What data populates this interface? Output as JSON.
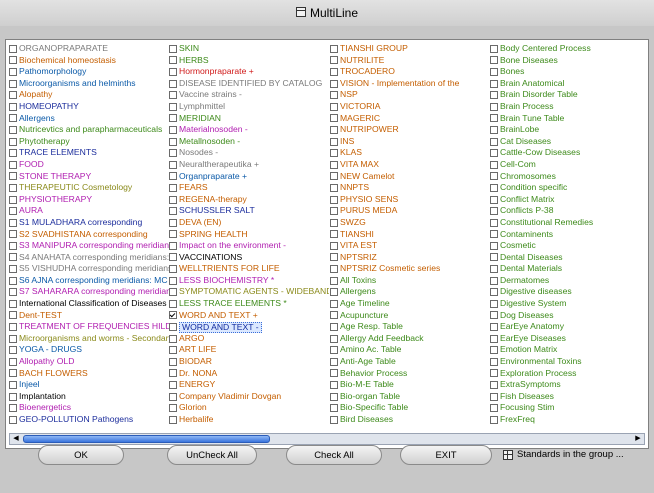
{
  "window": {
    "title": "MultiLine"
  },
  "columns": [
    [
      {
        "label": "ORGANOPRAPARATE",
        "color": "#7a7a7a"
      },
      {
        "label": "Biochemical homeostasis",
        "color": "#c45e00"
      },
      {
        "label": "Pathomorphology",
        "color": "#0b5aa8"
      },
      {
        "label": "Microorganisms and helminths",
        "color": "#0b5aa8"
      },
      {
        "label": "Alopathy",
        "color": "#c45e00"
      },
      {
        "label": "HOMEOPATHY",
        "color": "#1c2d9c"
      },
      {
        "label": "Allergens",
        "color": "#0b5aa8"
      },
      {
        "label": "Nutricevtics and parapharmaceuticals",
        "color": "#3d8a1a"
      },
      {
        "label": "Phytotherapy",
        "color": "#3d8a1a"
      },
      {
        "label": "TRACE ELEMENTS",
        "color": "#1c2d9c"
      },
      {
        "label": "FOOD",
        "color": "#b01eb0"
      },
      {
        "label": "STONE THERAPY",
        "color": "#b01eb0"
      },
      {
        "label": "THERAPEUTIC Cosmetology",
        "color": "#8a8a1a"
      },
      {
        "label": "PHYSIOTHERAPY",
        "color": "#b01eb0"
      },
      {
        "label": "AURA",
        "color": "#b01eb0"
      },
      {
        "label": "S1 MULADHARA corresponding",
        "color": "#1c2d9c"
      },
      {
        "label": "S2 SVADHISTANA corresponding",
        "color": "#c45e00"
      },
      {
        "label": "S3 MANIPURA corresponding meridians:",
        "color": "#b01eb0"
      },
      {
        "label": "S4 ANAHATA corresponding meridians:",
        "color": "#7a7a7a"
      },
      {
        "label": "S5 VISHUDHA corresponding meridians:",
        "color": "#7a7a7a"
      },
      {
        "label": "S6 AJNA corresponding meridians: MC",
        "color": "#0b5aa8"
      },
      {
        "label": "S7 SAHARARA corresponding meridians:",
        "color": "#b01eb0"
      },
      {
        "label": "International Classification of Diseases",
        "color": "#000000"
      },
      {
        "label": "Dent-TEST",
        "color": "#c45e00"
      },
      {
        "label": "TREATMENT OF FREQUENCIES HILDA",
        "color": "#b01eb0"
      },
      {
        "label": "Microorganisms and worms - Secondary",
        "color": "#8a8a1a"
      },
      {
        "label": "YOGA - DRUGS",
        "color": "#0b5aa8"
      },
      {
        "label": "Allopathy OLD",
        "color": "#b01eb0"
      },
      {
        "label": "BACH FLOWERS",
        "color": "#c45e00"
      },
      {
        "label": "Injeel",
        "color": "#0b5aa8"
      },
      {
        "label": "Implantation",
        "color": "#000000"
      },
      {
        "label": "Bioenergetics",
        "color": "#b01eb0"
      },
      {
        "label": "GEO-POLLUTION Pathogens",
        "color": "#1c2d9c"
      }
    ],
    [
      {
        "label": "SKIN",
        "color": "#3d8a1a"
      },
      {
        "label": "HERBS",
        "color": "#3d8a1a"
      },
      {
        "label": "Hormonpraparate +",
        "color": "#d01a1a"
      },
      {
        "label": "DISEASE IDENTIFIED BY CATALOG",
        "color": "#7a7a7a"
      },
      {
        "label": "Vaccine strains -",
        "color": "#7a7a7a"
      },
      {
        "label": "Lymphmittel",
        "color": "#7a7a7a"
      },
      {
        "label": "MERIDIAN",
        "color": "#3d8a1a"
      },
      {
        "label": "Materialnosoden -",
        "color": "#b01eb0"
      },
      {
        "label": "Metallnosoden -",
        "color": "#3d8a1a"
      },
      {
        "label": "Nosodes -",
        "color": "#7a7a7a"
      },
      {
        "label": "Neuraltherapeutika +",
        "color": "#7a7a7a"
      },
      {
        "label": "Organpraparate +",
        "color": "#0b5aa8"
      },
      {
        "label": "FEARS",
        "color": "#c45e00"
      },
      {
        "label": "REGENA-therapy",
        "color": "#c45e00"
      },
      {
        "label": "SCHUSSLER SALT",
        "color": "#1c2d9c"
      },
      {
        "label": "DEVA (EN)",
        "color": "#c45e00"
      },
      {
        "label": "SPRING HEALTH",
        "color": "#c45e00"
      },
      {
        "label": "Impact on the environment -",
        "color": "#b01eb0"
      },
      {
        "label": "VACCINATIONS",
        "color": "#000000"
      },
      {
        "label": "WELLTRIENTS FOR LIFE",
        "color": "#c45e00"
      },
      {
        "label": "LESS BIOCHEMISTRY *",
        "color": "#b01eb0"
      },
      {
        "label": "SYMPTOMATIC AGENTS - WIDEBAND",
        "color": "#8a8a1a"
      },
      {
        "label": "LESS TRACE ELEMENTS *",
        "color": "#3d8a1a"
      },
      {
        "label": "WORD AND TEXT +",
        "color": "#c45e00",
        "checked": true
      },
      {
        "label": "WORD AND TEXT -",
        "color": "#102a9e",
        "selected": true
      },
      {
        "label": "ARGO",
        "color": "#c45e00"
      },
      {
        "label": "ART LIFE",
        "color": "#c45e00"
      },
      {
        "label": "BIODAR",
        "color": "#c45e00"
      },
      {
        "label": "Dr. NONA",
        "color": "#c45e00"
      },
      {
        "label": "ENERGY",
        "color": "#c45e00"
      },
      {
        "label": "Company Vladimir Dovgan",
        "color": "#c45e00"
      },
      {
        "label": "Glorion",
        "color": "#c45e00"
      },
      {
        "label": "Herbalife",
        "color": "#c45e00"
      }
    ],
    [
      {
        "label": "TIANSHI GROUP",
        "color": "#c45e00"
      },
      {
        "label": "NUTRILITE",
        "color": "#c45e00"
      },
      {
        "label": "TROCADERO",
        "color": "#c45e00"
      },
      {
        "label": "VISION - Implementation of the",
        "color": "#c45e00"
      },
      {
        "label": "NSP",
        "color": "#c45e00"
      },
      {
        "label": "VICTORIA",
        "color": "#c45e00"
      },
      {
        "label": "MAGERIC",
        "color": "#c45e00"
      },
      {
        "label": "NUTRIPOWER",
        "color": "#c45e00"
      },
      {
        "label": "INS",
        "color": "#c45e00"
      },
      {
        "label": "KLAS",
        "color": "#c45e00"
      },
      {
        "label": "VITA MAX",
        "color": "#c45e00"
      },
      {
        "label": "NEW Camelot",
        "color": "#c45e00"
      },
      {
        "label": "NNPTS",
        "color": "#c45e00"
      },
      {
        "label": "PHYSIO SENS",
        "color": "#c45e00"
      },
      {
        "label": "PURUS MEDA",
        "color": "#c45e00"
      },
      {
        "label": "SWZG",
        "color": "#c45e00"
      },
      {
        "label": "TIANSHI",
        "color": "#c45e00"
      },
      {
        "label": "VITA EST",
        "color": "#c45e00"
      },
      {
        "label": "NPTSRIZ",
        "color": "#c45e00"
      },
      {
        "label": "NPTSRIZ Cosmetic series",
        "color": "#c45e00"
      },
      {
        "label": "All Toxins",
        "color": "#3d8a1a"
      },
      {
        "label": "Allergens",
        "color": "#3d8a1a"
      },
      {
        "label": "Age Timeline",
        "color": "#3d8a1a"
      },
      {
        "label": "Acupuncture",
        "color": "#3d8a1a"
      },
      {
        "label": "Age Resp. Table",
        "color": "#3d8a1a"
      },
      {
        "label": "Allergy Add Feedback",
        "color": "#3d8a1a"
      },
      {
        "label": "Amino Ac. Table",
        "color": "#3d8a1a"
      },
      {
        "label": "Anti-Age Table",
        "color": "#3d8a1a"
      },
      {
        "label": "Behavior Process",
        "color": "#3d8a1a"
      },
      {
        "label": "Bio-M-E Table",
        "color": "#3d8a1a"
      },
      {
        "label": "Bio-organ Table",
        "color": "#3d8a1a"
      },
      {
        "label": "Bio-Specific Table",
        "color": "#3d8a1a"
      },
      {
        "label": "Bird Diseases",
        "color": "#3d8a1a"
      }
    ],
    [
      {
        "label": "Body Centered Process",
        "color": "#3d8a1a"
      },
      {
        "label": "Bone Diseases",
        "color": "#3d8a1a"
      },
      {
        "label": "Bones",
        "color": "#3d8a1a"
      },
      {
        "label": "Brain Anatomical",
        "color": "#3d8a1a"
      },
      {
        "label": "Brain Disorder Table",
        "color": "#3d8a1a"
      },
      {
        "label": "Brain Process",
        "color": "#3d8a1a"
      },
      {
        "label": "Brain Tune Table",
        "color": "#3d8a1a"
      },
      {
        "label": "BrainLobe",
        "color": "#3d8a1a"
      },
      {
        "label": "Cat Diseases",
        "color": "#3d8a1a"
      },
      {
        "label": "Cattle-Cow Diseases",
        "color": "#3d8a1a"
      },
      {
        "label": "Cell-Com",
        "color": "#3d8a1a"
      },
      {
        "label": "Chromosomes",
        "color": "#3d8a1a"
      },
      {
        "label": "Condition specific",
        "color": "#3d8a1a"
      },
      {
        "label": "Conflict Matrix",
        "color": "#3d8a1a"
      },
      {
        "label": "Conflicts P-38",
        "color": "#3d8a1a"
      },
      {
        "label": "Constitutional Remedies",
        "color": "#3d8a1a"
      },
      {
        "label": "Contaminents",
        "color": "#3d8a1a"
      },
      {
        "label": "Cosmetic",
        "color": "#3d8a1a"
      },
      {
        "label": "Dental Diseases",
        "color": "#3d8a1a"
      },
      {
        "label": "Dental Materials",
        "color": "#3d8a1a"
      },
      {
        "label": "Dermatomes",
        "color": "#3d8a1a"
      },
      {
        "label": "Digestive diseases",
        "color": "#3d8a1a"
      },
      {
        "label": "Digestive System",
        "color": "#3d8a1a"
      },
      {
        "label": "Dog Diseases",
        "color": "#3d8a1a"
      },
      {
        "label": "EarEye Anatomy",
        "color": "#3d8a1a"
      },
      {
        "label": "EarEye Diseases",
        "color": "#3d8a1a"
      },
      {
        "label": "Emotion Matrix",
        "color": "#3d8a1a"
      },
      {
        "label": "Environmental Toxins",
        "color": "#3d8a1a"
      },
      {
        "label": "Exploration Process",
        "color": "#3d8a1a"
      },
      {
        "label": "ExtraSymptoms",
        "color": "#3d8a1a"
      },
      {
        "label": "Fish Diseases",
        "color": "#3d8a1a"
      },
      {
        "label": "Focusing Stim",
        "color": "#3d8a1a"
      },
      {
        "label": "FrexFreq",
        "color": "#3d8a1a"
      }
    ]
  ],
  "buttons": {
    "ok": "OK",
    "uncheck_all": "UnCheck All",
    "check_all": "Check All",
    "exit": "EXIT"
  },
  "standards_label": "Standards in the group ..."
}
